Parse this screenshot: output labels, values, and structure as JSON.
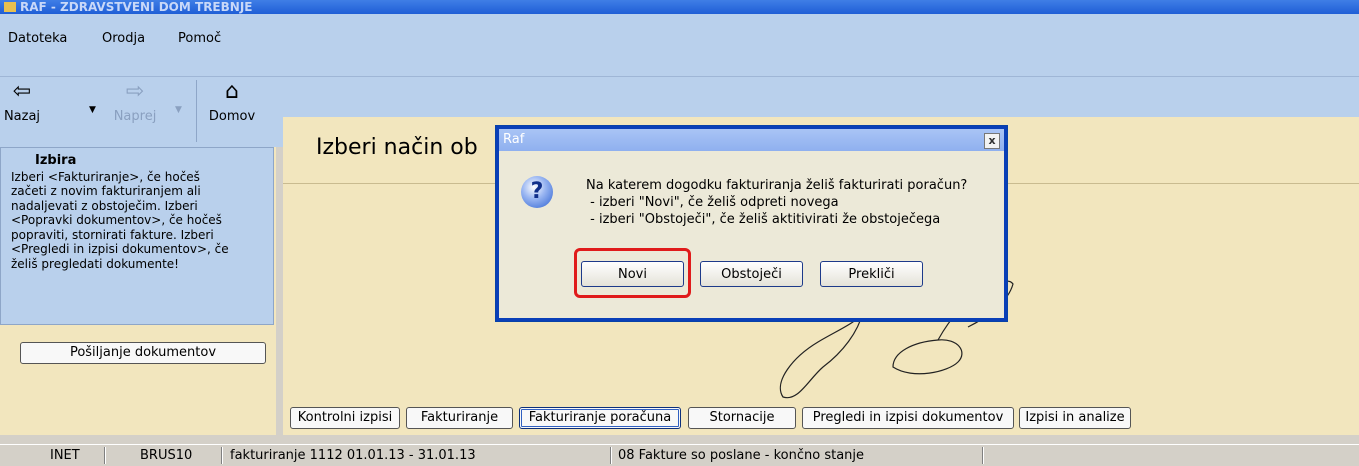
{
  "window": {
    "title": "RAF - ZDRAVSTVENI DOM TREBNJE"
  },
  "menu": [
    "Datoteka",
    "Orodja",
    "Pomoč"
  ],
  "nav": {
    "back_label": "Nazaj",
    "forward_label": "Naprej",
    "home_label": "Domov"
  },
  "info": {
    "heading": "Izbira",
    "lines": [
      "Izberi <Fakturiranje>, če hočeš",
      "začeti z novim fakturiranjem ali",
      "nadaljevati z obstoječim. Izberi",
      "<Popravki dokumentov>, če hočeš",
      "popraviti, stornirati fakture. Izberi",
      "<Pregledi in izpisi dokumentov>, če",
      "želiš pregledati dokumente!"
    ]
  },
  "send_button": "Pošiljanje dokumentov",
  "main": {
    "title": "Izberi način ob"
  },
  "bottom_buttons": [
    "Kontrolni izpisi",
    "Fakturiranje",
    "Fakturiranje poračuna",
    "Stornacije",
    "Pregledi in izpisi dokumentov",
    "Izpisi in analize"
  ],
  "status": {
    "connection": "INET",
    "user": "BRUS10",
    "period": "fakturiranje 1112  01.01.13 - 31.01.13",
    "state": "08 Fakture so poslane - končno stanje"
  },
  "dialog": {
    "title": "Raf",
    "close": "x",
    "icon": "question-icon",
    "icon_glyph": "?",
    "lines": [
      "Na katerem dogodku fakturiranja želiš fakturirati poračun?",
      " - izberi \"Novi\", če želiš odpreti novega",
      " - izberi \"Obstoječi\", če želiš aktitivirati že obstoječega"
    ],
    "buttons": [
      "Novi",
      "Obstoječi",
      "Prekliči"
    ]
  },
  "colors": {
    "highlight": "#e01b1b",
    "panel": "#b9d0ec",
    "content": "#f2e6be"
  }
}
